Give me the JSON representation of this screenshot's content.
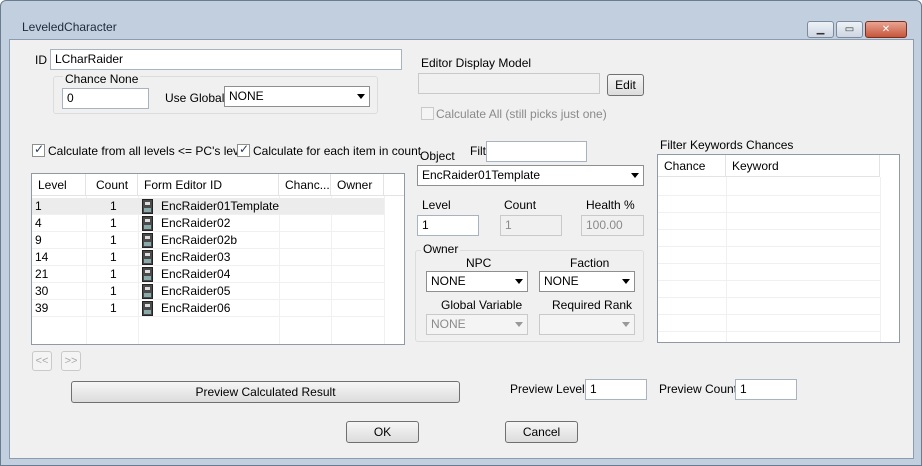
{
  "window": {
    "title": "LeveledCharacter",
    "minimize_icon": "minimize-icon",
    "maximize_icon": "maximize-icon",
    "close_icon": "close-icon"
  },
  "id_field": {
    "label": "ID",
    "value": "LCharRaider"
  },
  "chance_none": {
    "label": "Chance None",
    "value": "0",
    "use_global_label": "Use Global",
    "use_global_value": "NONE"
  },
  "editor_display_model": {
    "label": "Editor Display Model",
    "value": "",
    "edit_label": "Edit"
  },
  "calculate_all": {
    "label": "Calculate All (still picks just one)",
    "checked": false,
    "enabled": false
  },
  "calc_all_levels": {
    "label": "Calculate from all levels <= PC's level",
    "checked": true
  },
  "calc_each_item": {
    "label": "Calculate for each item in count",
    "checked": true
  },
  "entries": {
    "columns": [
      "Level",
      "Count",
      "Form Editor ID",
      "Chanc...",
      "Owner"
    ],
    "rows": [
      {
        "level": "1",
        "count": "1",
        "id": "EncRaider01Template",
        "selected": true
      },
      {
        "level": "4",
        "count": "1",
        "id": "EncRaider02"
      },
      {
        "level": "9",
        "count": "1",
        "id": "EncRaider02b"
      },
      {
        "level": "14",
        "count": "1",
        "id": "EncRaider03"
      },
      {
        "level": "21",
        "count": "1",
        "id": "EncRaider04"
      },
      {
        "level": "30",
        "count": "1",
        "id": "EncRaider05"
      },
      {
        "level": "39",
        "count": "1",
        "id": "EncRaider06"
      }
    ],
    "row_icon": "npc-icon"
  },
  "nav": {
    "prev_label": "<<",
    "next_label": ">>"
  },
  "object": {
    "label": "Object",
    "filter_label": "Filter",
    "filter_value": "",
    "value": "EncRaider01Template"
  },
  "level": {
    "label": "Level",
    "value": "1"
  },
  "count": {
    "label": "Count",
    "value": "1"
  },
  "health": {
    "label": "Health %",
    "value": "100.00"
  },
  "owner": {
    "label": "Owner",
    "npc_label": "NPC",
    "npc_value": "NONE",
    "faction_label": "Faction",
    "faction_value": "NONE",
    "global_var_label": "Global Variable",
    "global_var_value": "NONE",
    "required_rank_label": "Required Rank",
    "required_rank_value": ""
  },
  "filter_keywords": {
    "label": "Filter Keywords Chances",
    "columns": [
      "Chance",
      "Keyword"
    ]
  },
  "preview": {
    "button_label": "Preview Calculated Result",
    "level_label": "Preview Level",
    "level_value": "1",
    "count_label": "Preview Count",
    "count_value": "1"
  },
  "dialog": {
    "ok_label": "OK",
    "cancel_label": "Cancel"
  }
}
